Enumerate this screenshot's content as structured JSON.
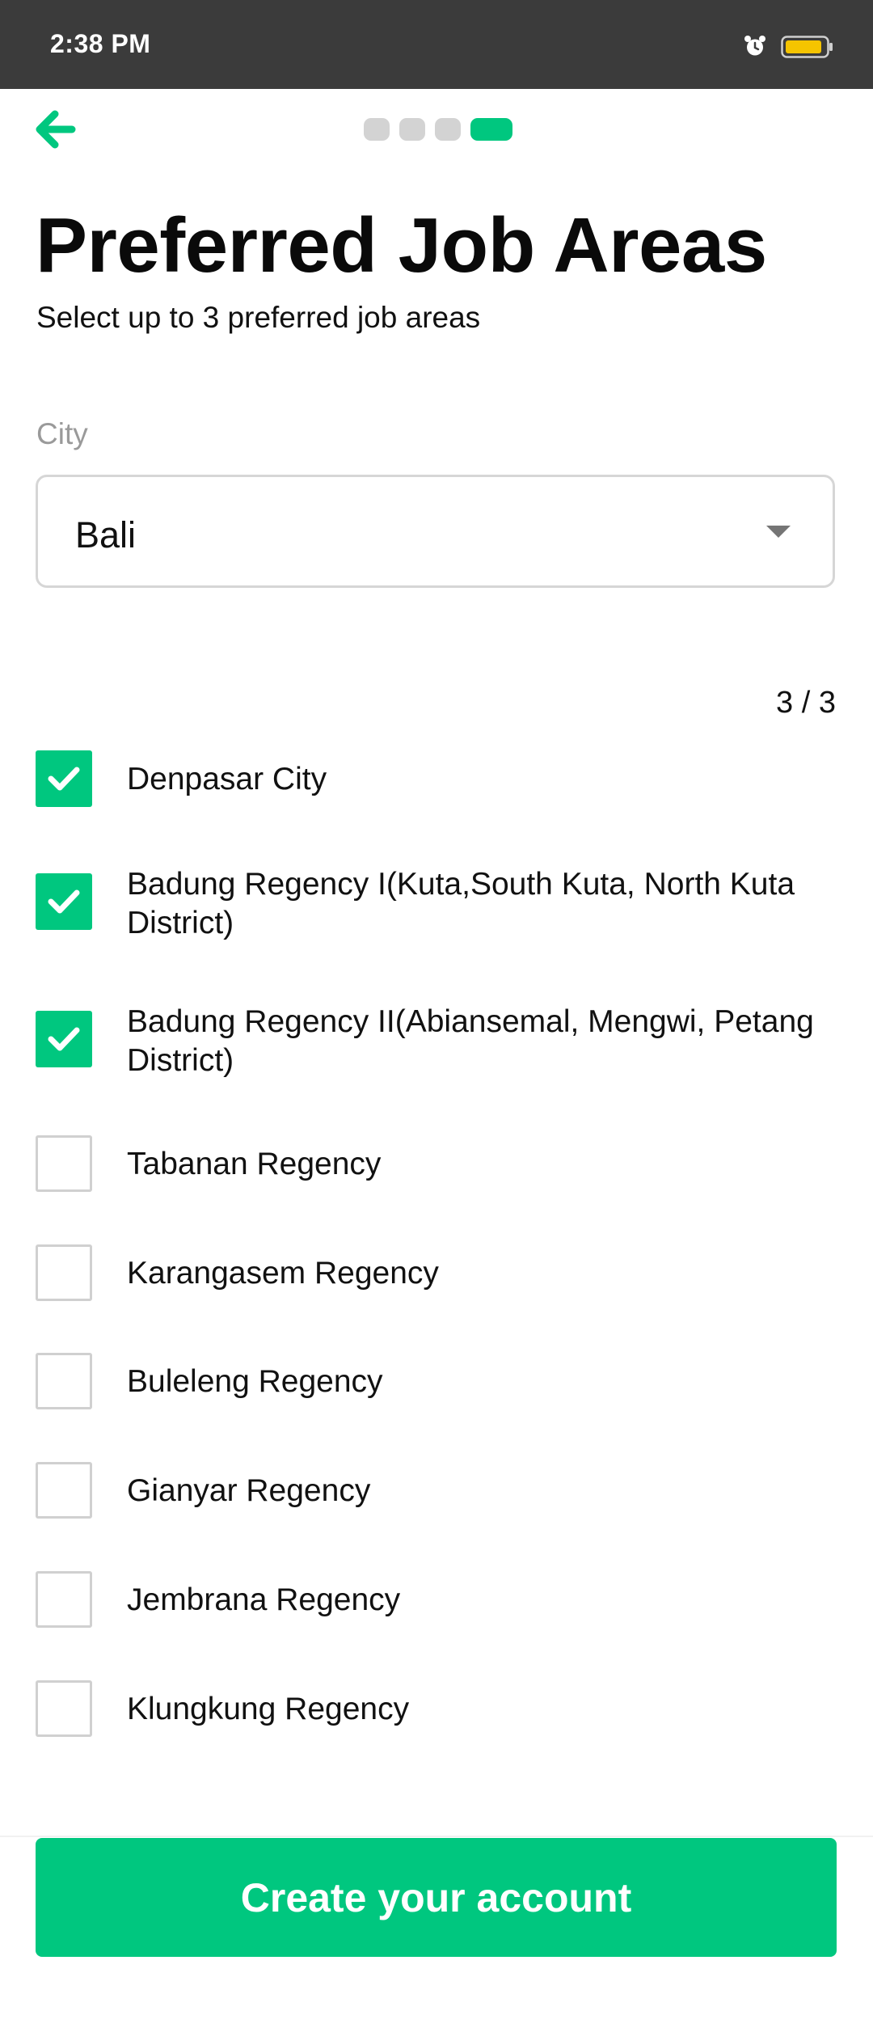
{
  "status_bar": {
    "time": "2:38 PM",
    "icons": [
      "alarm-icon",
      "battery-icon"
    ],
    "battery_color": "#f5c400"
  },
  "nav": {
    "back_icon": "arrow-left-icon",
    "progress_steps": 4,
    "progress_current": 4
  },
  "header": {
    "title": "Preferred Job Areas",
    "subtitle": "Select up to 3 preferred job areas"
  },
  "city": {
    "label": "City",
    "value": "Bali"
  },
  "counter": "3 / 3",
  "options": [
    {
      "label": "Denpasar City",
      "checked": true
    },
    {
      "label": "Badung Regency I(Kuta,South Kuta, North Kuta District)",
      "checked": true
    },
    {
      "label": "Badung Regency II(Abiansemal, Mengwi, Petang District)",
      "checked": true
    },
    {
      "label": "Tabanan Regency",
      "checked": false
    },
    {
      "label": "Karangasem Regency",
      "checked": false
    },
    {
      "label": "Buleleng Regency",
      "checked": false
    },
    {
      "label": "Gianyar Regency",
      "checked": false
    },
    {
      "label": "Jembrana Regency",
      "checked": false
    },
    {
      "label": "Klungkung Regency",
      "checked": false
    }
  ],
  "footer": {
    "cta_label": "Create your account"
  },
  "colors": {
    "accent": "#00c77f",
    "status_bar": "#3b3b3b",
    "checkbox_border": "#d0d0d0"
  }
}
